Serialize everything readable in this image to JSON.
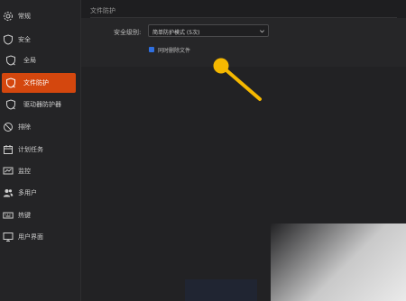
{
  "sidebar": {
    "items": [
      {
        "label": "常规",
        "icon": "gear-icon"
      },
      {
        "label": "安全",
        "icon": "shield-icon"
      },
      {
        "label": "全局",
        "icon": "shield-refresh-icon"
      },
      {
        "label": "文件防护",
        "icon": "file-shield-icon",
        "active": true
      },
      {
        "label": "驱动器防护器",
        "icon": "drive-shield-icon"
      },
      {
        "label": "排除",
        "icon": "block-icon"
      },
      {
        "label": "计划任务",
        "icon": "calendar-icon"
      },
      {
        "label": "监控",
        "icon": "monitor-icon"
      },
      {
        "label": "多用户",
        "icon": "users-icon"
      },
      {
        "label": "热键",
        "icon": "keyboard-icon"
      },
      {
        "label": "用户界面",
        "icon": "display-icon"
      }
    ]
  },
  "main": {
    "section_title": "文件防护",
    "security_label": "安全级别:",
    "dropdown_value": "简单防护模式 (5次)",
    "checkbox_label": "同时删除文件",
    "checkbox_checked": true
  },
  "colors": {
    "accent": "#d4470e",
    "checkbox": "#2f6fe0",
    "pointer": "#f5b800"
  }
}
